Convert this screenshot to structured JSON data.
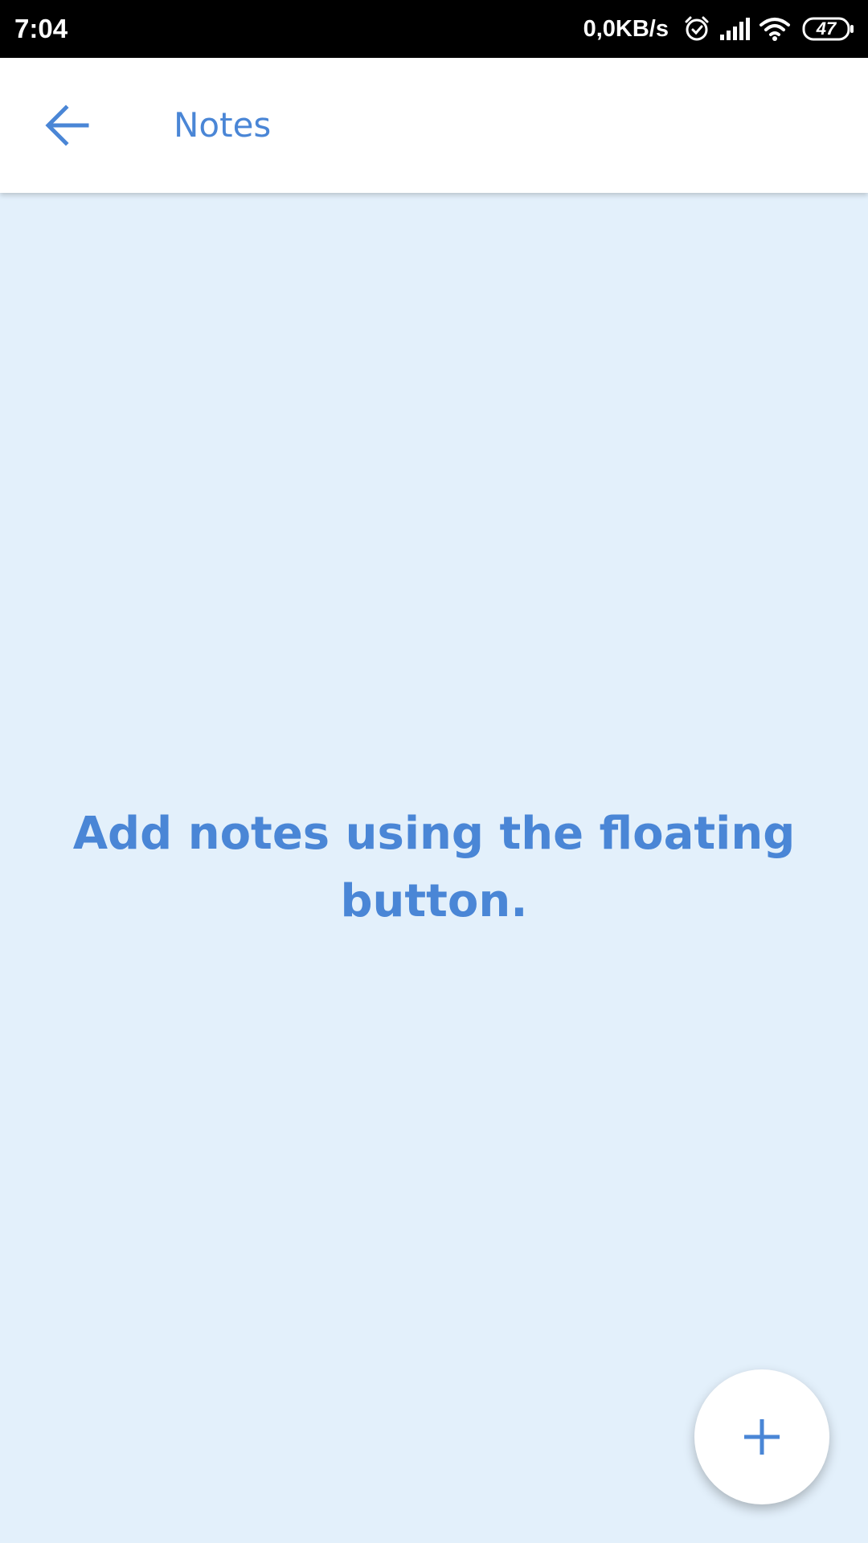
{
  "status_bar": {
    "time": "7:04",
    "net_speed": "0,0KB/s",
    "battery": "47",
    "icons": [
      "alarm-icon",
      "signal-icon",
      "wifi-icon",
      "battery-icon"
    ]
  },
  "app_bar": {
    "back_icon": "arrow-left-icon",
    "title": "Notes"
  },
  "main": {
    "empty_message": "Add notes using the floating button."
  },
  "fab": {
    "icon": "plus-icon"
  },
  "colors": {
    "accent": "#4a86d6",
    "background": "#e3f0fb",
    "app_bar": "#ffffff",
    "status_bar": "#000000"
  }
}
